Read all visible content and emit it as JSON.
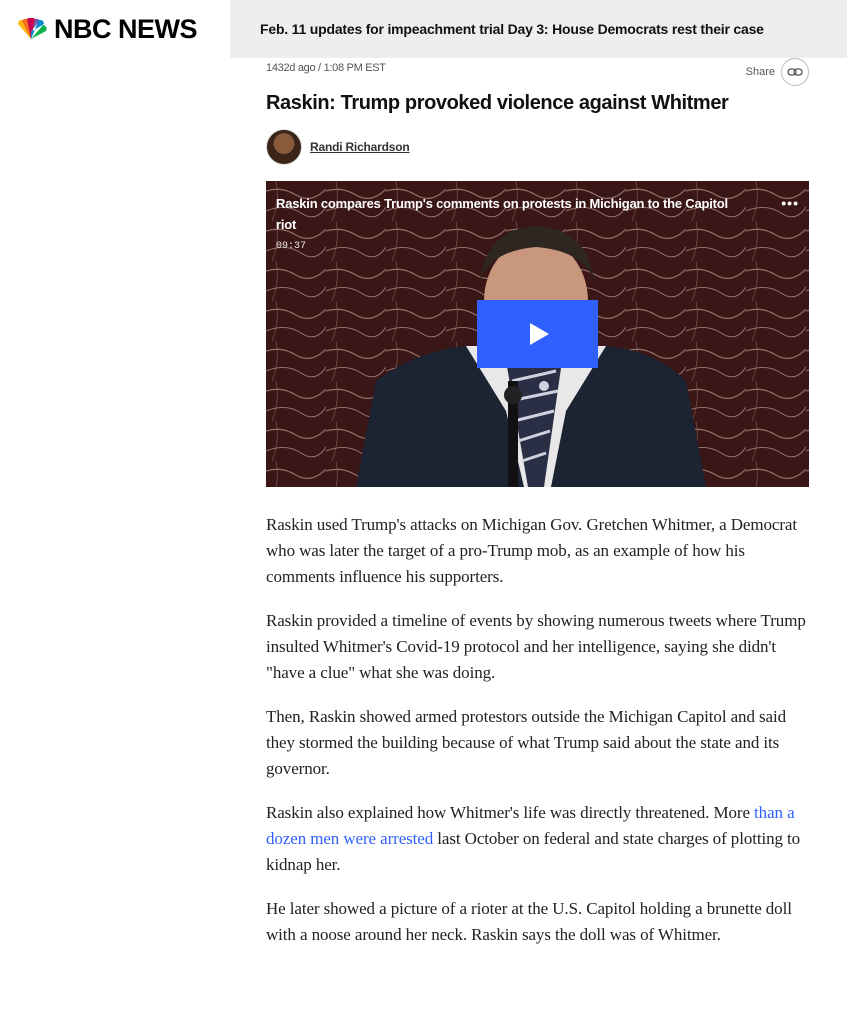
{
  "header": {
    "brand": "NBC NEWS",
    "headline": "Feb. 11 updates for impeachment trial Day 3: House Democrats rest their case"
  },
  "post": {
    "timestamp": "1432d ago / 1:08 PM EST",
    "share_label": "Share",
    "title": "Raskin: Trump provoked violence against Whitmer",
    "author": "Randi Richardson"
  },
  "video": {
    "title": "Raskin compares Trump's comments on protests in Michigan to the Capitol riot",
    "duration": "09:37",
    "more": "•••"
  },
  "body": {
    "p1": "Raskin used Trump's attacks on Michigan Gov. Gretchen Whitmer, a Democrat who was later the target of a pro-Trump mob, as an example of how his comments influence his supporters.",
    "p2": "Raskin provided a timeline of events by showing numerous tweets where Trump insulted Whitmer's Covid-19 protocol and her intelligence, saying she didn't \"have a clue\" what she was doing.",
    "p3": "Then, Raskin showed armed protestors outside the Michigan Capitol and said they stormed the building because of what Trump said about the state and its governor.",
    "p4_before": "Raskin also explained how Whitmer's life was directly threatened. More ",
    "p4_link": "than a dozen men were arrested",
    "p4_after": "  last October on federal and state charges of plotting to kidnap her.",
    "p5": "He later showed a picture of a rioter at the U.S. Capitol holding a brunette doll with a noose around her neck. Raskin says the doll was of Whitmer."
  },
  "colors": {
    "accent": "#3061ff",
    "headline_bar": "#eeeeee"
  }
}
